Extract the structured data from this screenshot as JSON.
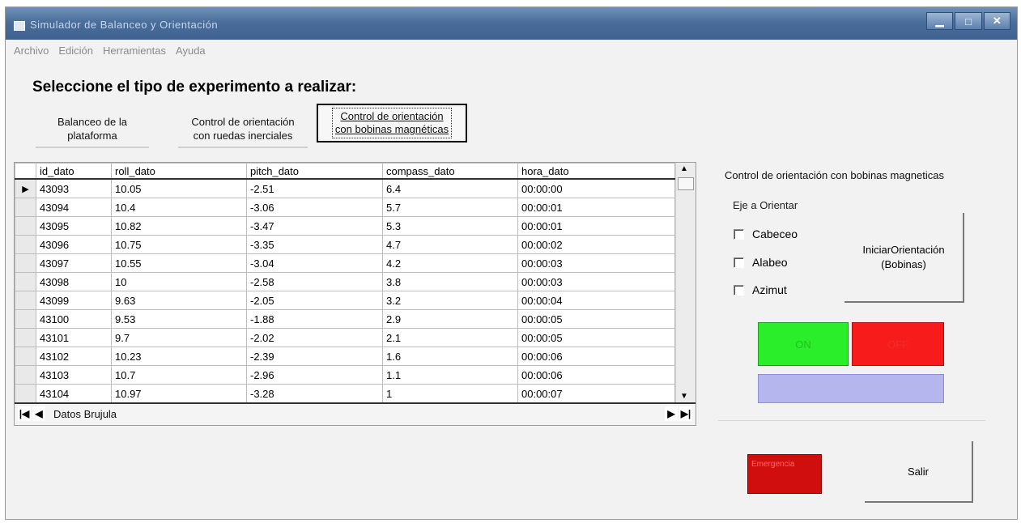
{
  "window": {
    "title": "Simulador de Balanceo y Orientación",
    "controls": [
      "▁",
      "□",
      "✕"
    ]
  },
  "menu": [
    "Archivo",
    "Edición",
    "Herramientas",
    "Ayuda"
  ],
  "heading": "Seleccione el tipo de experimento a realizar:",
  "experiments": {
    "balanceo_1": "Balanceo de la",
    "balanceo_2": "plataforma",
    "ruedas_1": "Control de orientación",
    "ruedas_2": "con ruedas inerciales",
    "bobinas_1": "Control de orientación",
    "bobinas_2": "con bobinas magnéticas"
  },
  "grid": {
    "columns": [
      "id_dato",
      "roll_dato",
      "pitch_dato",
      "compass_dato",
      "hora_dato"
    ],
    "rows": [
      [
        "43093",
        "10.05",
        "-2.51",
        "6.4",
        "00:00:00"
      ],
      [
        "43094",
        "10.4",
        "-3.06",
        "5.7",
        "00:00:01"
      ],
      [
        "43095",
        "10.82",
        "-3.47",
        "5.3",
        "00:00:01"
      ],
      [
        "43096",
        "10.75",
        "-3.35",
        "4.7",
        "00:00:02"
      ],
      [
        "43097",
        "10.55",
        "-3.04",
        "4.2",
        "00:00:03"
      ],
      [
        "43098",
        "10",
        "-2.58",
        "3.8",
        "00:00:03"
      ],
      [
        "43099",
        "9.63",
        "-2.05",
        "3.2",
        "00:00:04"
      ],
      [
        "43100",
        "9.53",
        "-1.88",
        "2.9",
        "00:00:05"
      ],
      [
        "43101",
        "9.7",
        "-2.02",
        "2.1",
        "00:00:05"
      ],
      [
        "43102",
        "10.23",
        "-2.39",
        "1.6",
        "00:00:06"
      ],
      [
        "43103",
        "10.7",
        "-2.96",
        "1.1",
        "00:00:06"
      ],
      [
        "43104",
        "10.97",
        "-3.28",
        "1",
        "00:00:07"
      ]
    ],
    "current_row_marker": "▶",
    "caption": "Datos Brujula",
    "nav": {
      "first": "|◀",
      "prev": "◀",
      "next": "▶",
      "last": "▶|"
    }
  },
  "panel": {
    "title": "Control de orientación con bobinas magneticas",
    "axis_label": "Eje a Orientar",
    "checkboxes": [
      "Cabeceo",
      "Alabeo",
      "Azimut"
    ],
    "start_1": "IniciarOrientación",
    "start_2": "(Bobinas)",
    "led_on": "ON",
    "led_off": "OFF",
    "emergency": "Emergencia",
    "exit": "Salir"
  },
  "colors": {
    "led_on": "#2bee2b",
    "led_off": "#f71b1b",
    "status_bar": "#b6b6ef",
    "emergency": "#d10e0e",
    "titlebar": "#4b6f9c"
  }
}
